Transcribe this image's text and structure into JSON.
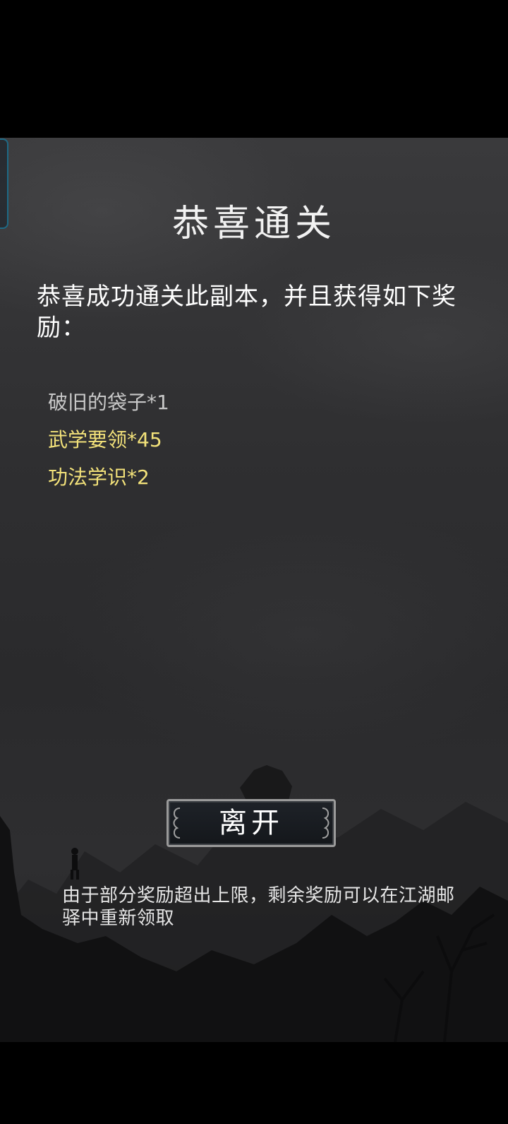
{
  "dialog": {
    "title": "恭喜通关",
    "message": "恭喜成功通关此副本，并且获得如下奖励：",
    "rewards": [
      {
        "label": "破旧的袋子*1",
        "color": "#c8c8c8"
      },
      {
        "label": "武学要领*45",
        "color": "#f3e27a"
      },
      {
        "label": "功法学识*2",
        "color": "#f3e27a"
      }
    ],
    "leave_label": "离开",
    "notice": "由于部分奖励超出上限，剩余奖励可以在江湖邮驿中重新领取"
  },
  "icons": {
    "button_ornaments": "scroll-ornament-icon",
    "edge_tab": "side-tab"
  },
  "colors": {
    "background": "#2f2f31",
    "title": "#f2f2f2",
    "reward_common": "#c8c8c8",
    "reward_highlight": "#f3e27a",
    "edge_tab_border": "#1e6a86"
  }
}
